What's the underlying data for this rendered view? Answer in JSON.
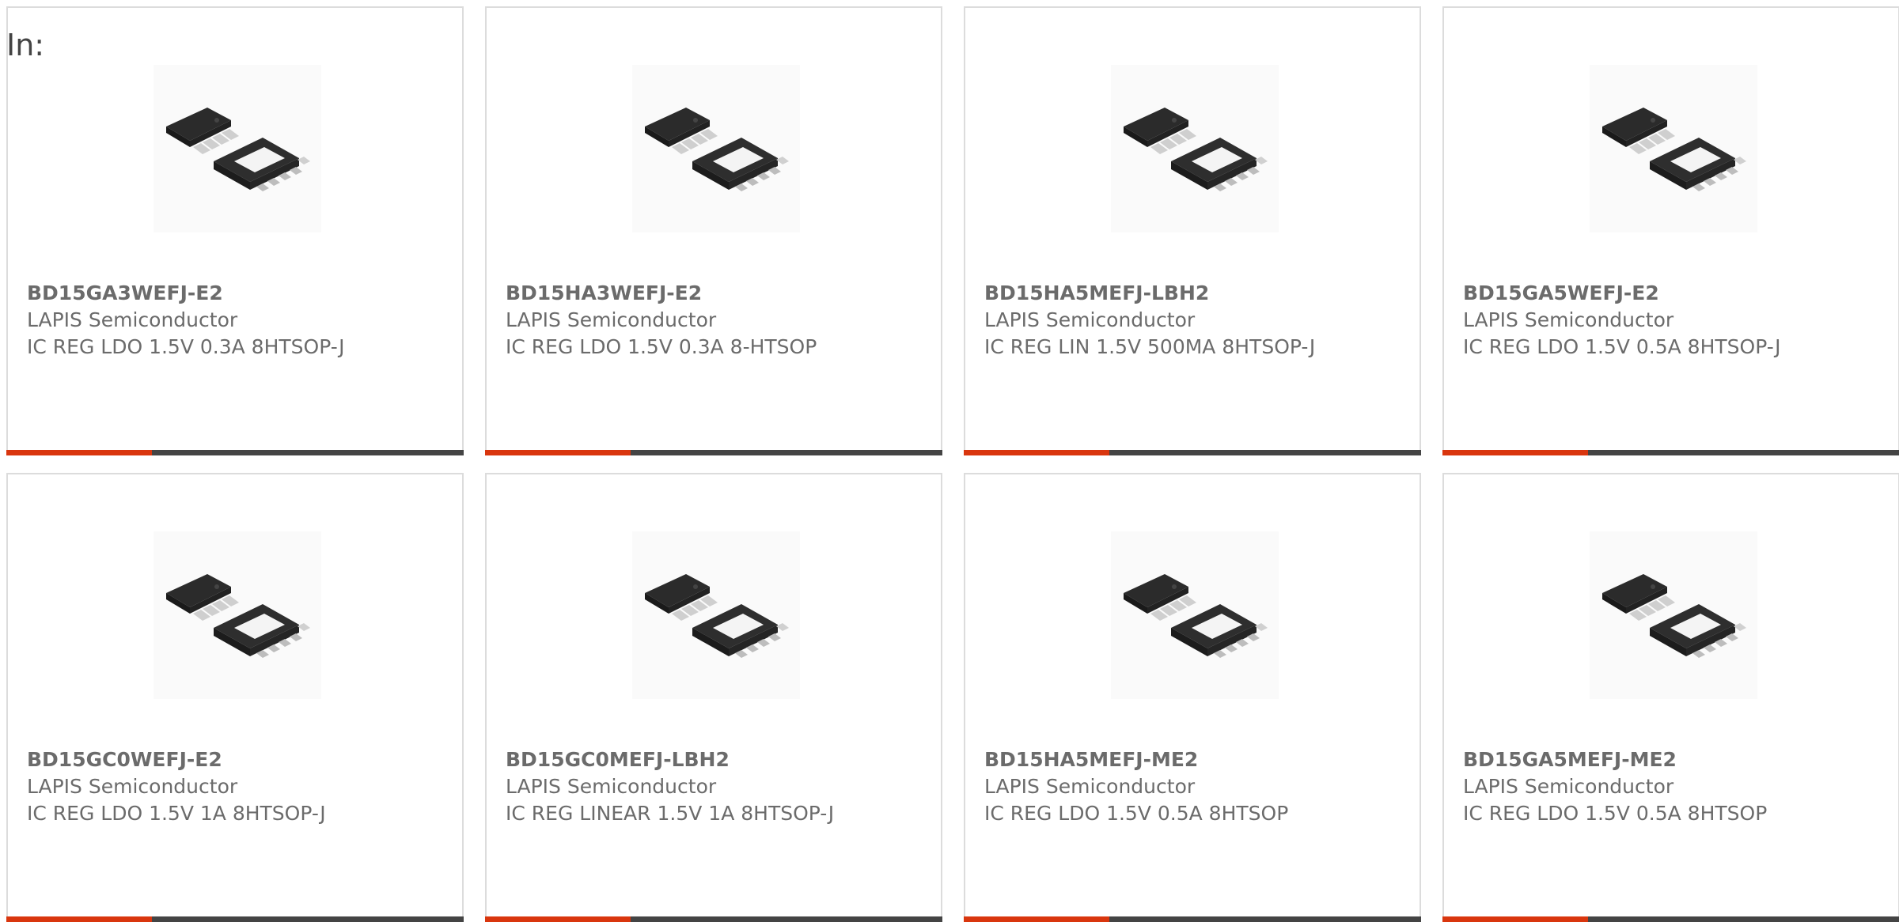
{
  "header": {
    "in_label": "In:"
  },
  "colors": {
    "accent": "#d9360e",
    "bar": "#444444",
    "text": "#6b6b6b",
    "border": "#dcdcdc"
  },
  "products": [
    {
      "part": "BD15GA3WEFJ-E2",
      "manufacturer": "LAPIS Semiconductor",
      "description": "IC REG LDO 1.5V 0.3A 8HTSOP-J",
      "image_icon": "ic-chip-htsop8-icon"
    },
    {
      "part": "BD15HA3WEFJ-E2",
      "manufacturer": "LAPIS Semiconductor",
      "description": "IC REG LDO 1.5V 0.3A 8-HTSOP",
      "image_icon": "ic-chip-htsop8-icon"
    },
    {
      "part": "BD15HA5MEFJ-LBH2",
      "manufacturer": "LAPIS Semiconductor",
      "description": "IC REG LIN 1.5V 500MA 8HTSOP-J",
      "image_icon": "ic-chip-htsop8-icon"
    },
    {
      "part": "BD15GA5WEFJ-E2",
      "manufacturer": "LAPIS Semiconductor",
      "description": "IC REG LDO 1.5V 0.5A 8HTSOP-J",
      "image_icon": "ic-chip-htsop8-icon"
    },
    {
      "part": "BD15GC0WEFJ-E2",
      "manufacturer": "LAPIS Semiconductor",
      "description": "IC REG LDO 1.5V 1A 8HTSOP-J",
      "image_icon": "ic-chip-htsop8-icon"
    },
    {
      "part": "BD15GC0MEFJ-LBH2",
      "manufacturer": "LAPIS Semiconductor",
      "description": "IC REG LINEAR 1.5V 1A 8HTSOP-J",
      "image_icon": "ic-chip-htsop8-icon"
    },
    {
      "part": "BD15HA5MEFJ-ME2",
      "manufacturer": "LAPIS Semiconductor",
      "description": "IC REG LDO 1.5V 0.5A 8HTSOP",
      "image_icon": "ic-chip-htsop8-icon"
    },
    {
      "part": "BD15GA5MEFJ-ME2",
      "manufacturer": "LAPIS Semiconductor",
      "description": "IC REG LDO 1.5V 0.5A 8HTSOP",
      "image_icon": "ic-chip-htsop8-icon"
    }
  ]
}
